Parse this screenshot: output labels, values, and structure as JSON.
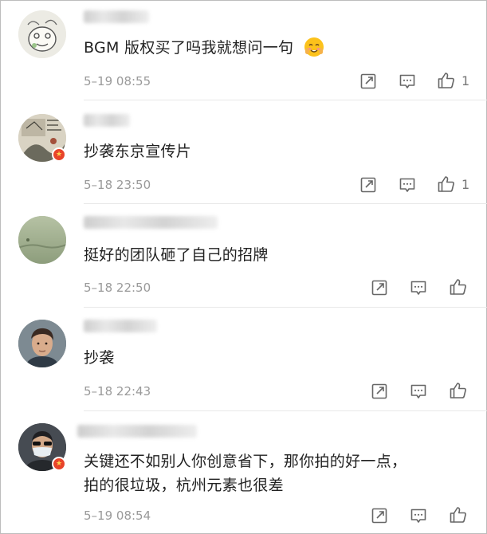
{
  "comments": [
    {
      "text_lines": [
        "BGM 版权买了吗我就想问一句"
      ],
      "emoji": "blushing-face-emoji",
      "time": "5–19 08:55",
      "like_count": "1",
      "avatar": "cartoon-doodle-avatar",
      "verified": false
    },
    {
      "text_lines": [
        "抄袭东京宣传片"
      ],
      "time": "5–18 23:50",
      "like_count": "1",
      "avatar": "ink-painting-avatar",
      "verified": true
    },
    {
      "text_lines": [
        "挺好的团队砸了自己的招牌"
      ],
      "time": "5–18 22:50",
      "like_count": "",
      "avatar": "green-landscape-avatar",
      "verified": false
    },
    {
      "text_lines": [
        "抄袭"
      ],
      "time": "5–18 22:43",
      "like_count": "",
      "avatar": "man-portrait-avatar",
      "verified": false
    },
    {
      "text_lines": [
        "关键还不如别人你创意省下，那你拍的好一点，",
        "拍的很垃圾，杭州元素也很差"
      ],
      "time": "5–19 08:54",
      "like_count": "",
      "avatar": "masked-person-avatar",
      "verified": true
    }
  ],
  "icons": {
    "repost": "repost-icon",
    "comment": "comment-icon",
    "like": "thumbs-up-icon"
  },
  "colors": {
    "verified_badge": "#e8442a",
    "secondary_text": "#9a9a9a",
    "icon": "#666666"
  }
}
